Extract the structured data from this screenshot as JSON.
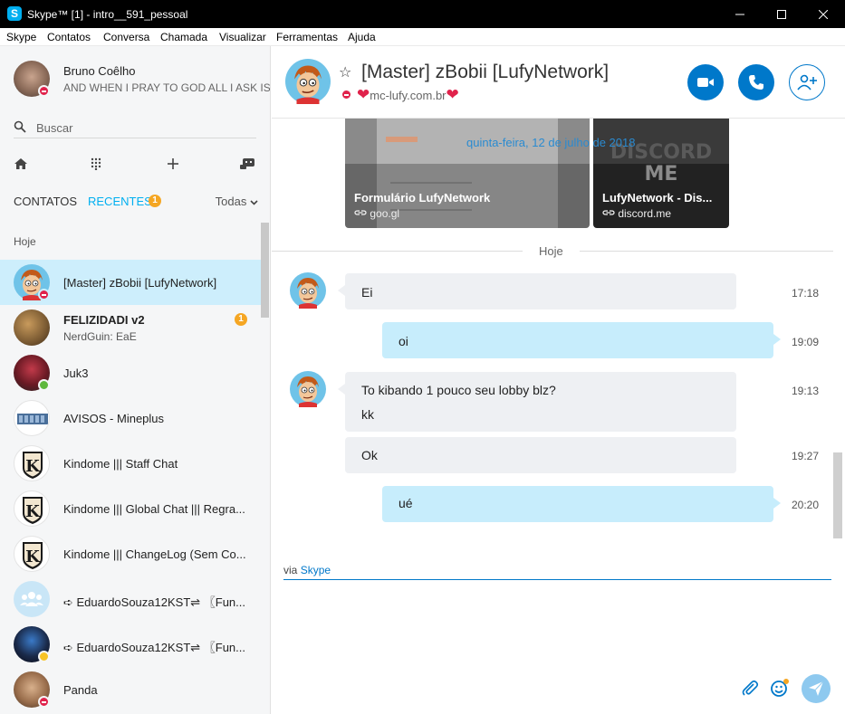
{
  "window": {
    "title": "Skype™ [1] - intro__591_pessoal",
    "logo_letter": "S"
  },
  "menu": [
    "Skype",
    "Contatos",
    "Conversa",
    "Chamada",
    "Visualizar",
    "Ferramentas",
    "Ajuda"
  ],
  "profile": {
    "name": "Bruno Coêlho",
    "mood": "AND WHEN I PRAY TO GOD ALL I ASK IS"
  },
  "search": {
    "placeholder": "Buscar"
  },
  "tabs": {
    "contacts": "CONTATOS",
    "recent": "RECENTES",
    "recent_badge": "1",
    "filter": "Todas"
  },
  "section_header": "Hoje",
  "conversations": [
    {
      "name": "[Master] zBobii [LufyNetwork]",
      "status": "dnd"
    },
    {
      "name": "FELIZIDADI v2",
      "subtitle": "NerdGuin: EaE",
      "unread": "1"
    },
    {
      "name": "Juk3",
      "status": "online"
    },
    {
      "name": "AVISOS - Mineplus"
    },
    {
      "name": "Kindome ||| Staff Chat"
    },
    {
      "name": "Kindome ||| Global Chat ||| Regra..."
    },
    {
      "name": "Kindome ||| ChangeLog (Sem Co..."
    },
    {
      "name": "➪ EduardoSouza12KST⇌ 〖Fun..."
    },
    {
      "name": "➪ EduardoSouza12KST⇌ 〖Fun...",
      "status": "away"
    },
    {
      "name": "Panda",
      "status": "dnd"
    }
  ],
  "chat": {
    "title": "[Master] zBobii [LufyNetwork]",
    "subtitle": "mc-lufy.com.br",
    "subtitle_heart": "❤",
    "cards": [
      {
        "title": "Formulário LufyNetwork",
        "domain": "goo.gl"
      },
      {
        "title": "LufyNetwork - Dis...",
        "domain": "discord.me",
        "thumb_text": "DISCORD\nME"
      }
    ],
    "date_label": "quinta-feira, 12 de julho de 2018",
    "today_label": "Hoje",
    "messages": [
      {
        "dir": "in",
        "lines": [
          "Ei"
        ],
        "time": "17:18"
      },
      {
        "dir": "out",
        "lines": [
          "oi"
        ],
        "time": "19:09"
      },
      {
        "dir": "in",
        "lines": [
          "To kibando 1 pouco seu lobby blz?",
          "kk"
        ],
        "time": "19:13"
      },
      {
        "dir": "in",
        "lines": [
          "Ok"
        ],
        "time": "19:27"
      },
      {
        "dir": "out",
        "lines": [
          "ué"
        ],
        "time": "20:20"
      }
    ]
  },
  "composer": {
    "via_prefix": "via",
    "via_link": "Skype"
  },
  "colors": {
    "accent": "#00aff0",
    "button_blue": "#0078ca",
    "active_row": "#cdeefc",
    "dnd": "#e0224b",
    "online": "#5fb83d",
    "badge": "#f5a623"
  }
}
